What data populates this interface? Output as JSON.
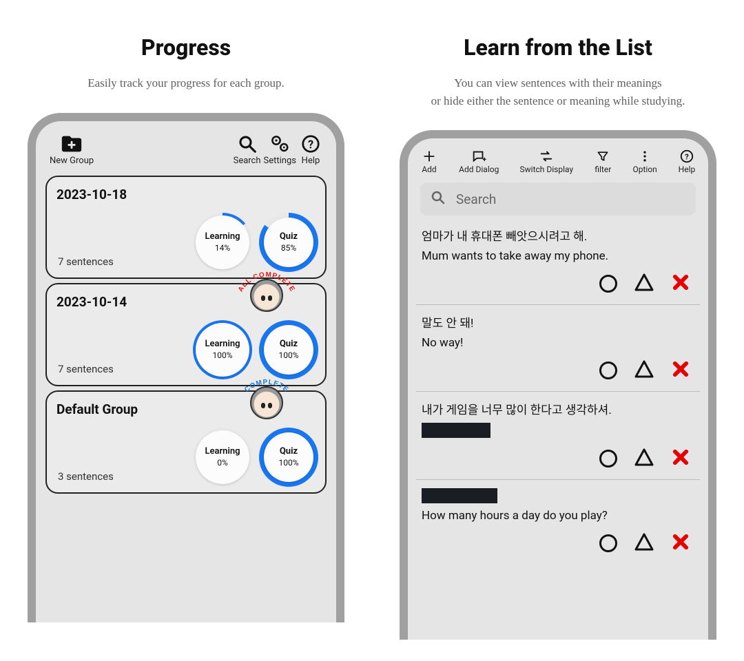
{
  "left": {
    "headline": "Progress",
    "subhead": "Easily track your progress for each group.",
    "toolbar": {
      "newgroup": "New Group",
      "search": "Search",
      "settings": "Settings",
      "help": "Help"
    },
    "labels": {
      "learning": "Learning",
      "quiz": "Quiz"
    },
    "groups": [
      {
        "title": "2023-10-18",
        "count": "7 sentences",
        "learning_pct": 14,
        "quiz_pct": 85,
        "badge": null
      },
      {
        "title": "2023-10-14",
        "count": "7 sentences",
        "learning_pct": 100,
        "quiz_pct": 100,
        "badge": "ALL COMPLETE"
      },
      {
        "title": "Default Group",
        "count": "3 sentences",
        "learning_pct": 0,
        "quiz_pct": 100,
        "badge": "COMPLETE"
      }
    ]
  },
  "right": {
    "headline": "Learn from the List",
    "subhead": "You can view sentences with their meanings\nor hide either the sentence or meaning while studying.",
    "toolbar": {
      "add": "Add",
      "adddialog": "Add Dialog",
      "switch": "Switch Display",
      "filter": "filter",
      "option": "Option",
      "help": "Help"
    },
    "search_placeholder": "Search",
    "rows": [
      {
        "ko": "엄마가 내 휴대폰 빼앗으시려고 해.",
        "en": "Mum wants to take away my phone.",
        "hide_ko": false,
        "hide_en": false
      },
      {
        "ko": "말도 안 돼!",
        "en": "No way!",
        "hide_ko": false,
        "hide_en": false
      },
      {
        "ko": "내가 게임을 너무 많이 한다고 생각하셔.",
        "en": "",
        "hide_ko": false,
        "hide_en": true,
        "redact_en_w": 100
      },
      {
        "ko": "",
        "en": "How many hours a day do you play?",
        "hide_ko": true,
        "hide_en": false,
        "redact_ko_w": 110
      }
    ]
  },
  "colors": {
    "ring_blue": "#1976f0",
    "ring_bg": "#e8e8e8",
    "x_red": "#e60000"
  }
}
